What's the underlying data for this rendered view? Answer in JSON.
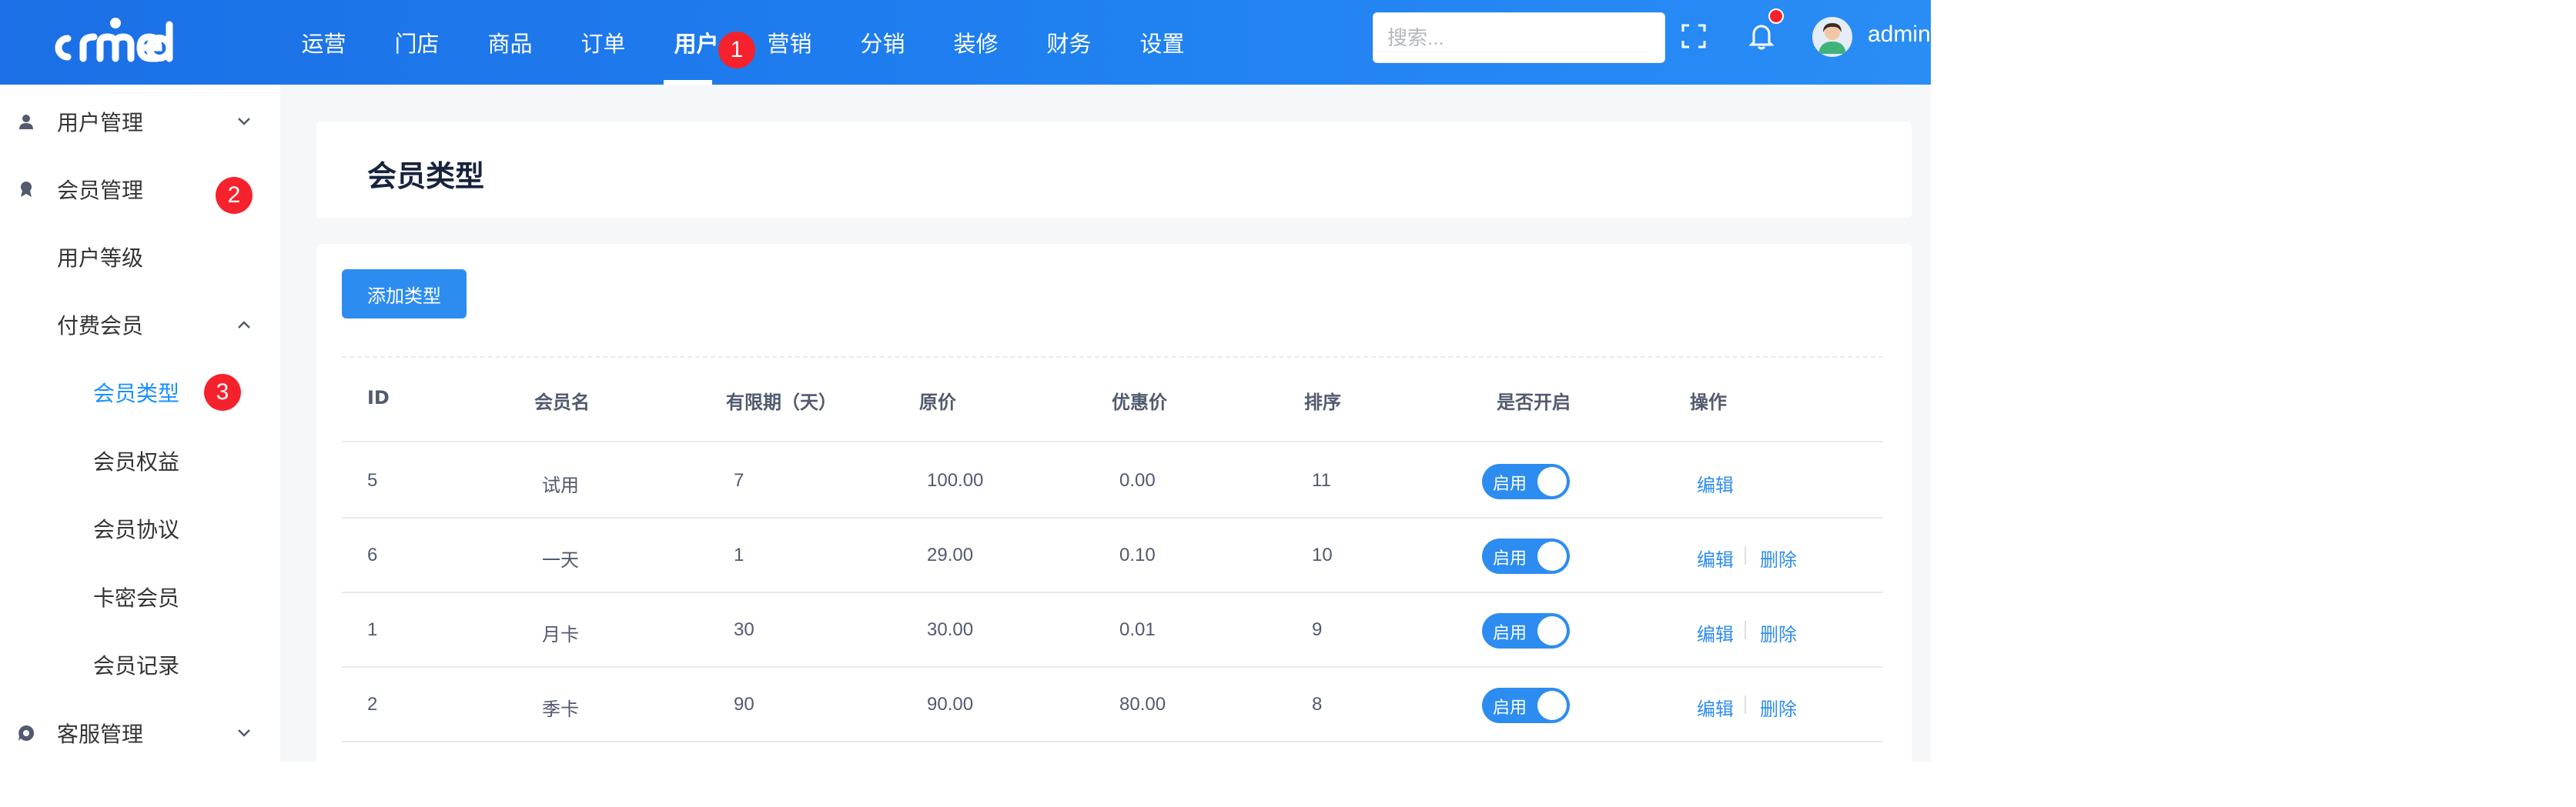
{
  "header": {
    "logo_text": "crmeb",
    "nav": [
      {
        "label": "运营"
      },
      {
        "label": "门店"
      },
      {
        "label": "商品"
      },
      {
        "label": "订单"
      },
      {
        "label": "用户",
        "active": true
      },
      {
        "label": "营销"
      },
      {
        "label": "分销"
      },
      {
        "label": "装修"
      },
      {
        "label": "财务"
      },
      {
        "label": "设置"
      }
    ],
    "search_placeholder": "搜索...",
    "username": "admin",
    "icons": [
      "fullscreen-icon",
      "bell-icon"
    ],
    "accent_color": "#1f80f0"
  },
  "markers": {
    "m1": "1",
    "m2": "2",
    "m3": "3"
  },
  "sidebar": {
    "items": [
      {
        "label": "用户管理"
      },
      {
        "label": "会员管理"
      },
      {
        "label": "用户等级"
      },
      {
        "label": "付费会员"
      },
      {
        "label": "会员类型",
        "active": true
      },
      {
        "label": "会员权益"
      },
      {
        "label": "会员协议"
      },
      {
        "label": "卡密会员"
      },
      {
        "label": "会员记录"
      },
      {
        "label": "客服管理"
      }
    ]
  },
  "page": {
    "title": "会员类型",
    "add_button": "添加类型"
  },
  "table": {
    "headers": [
      "ID",
      "会员名",
      "有限期（天）",
      "原价",
      "优惠价",
      "排序",
      "是否开启",
      "操作"
    ],
    "switch_label": "启用",
    "edit_label": "编辑",
    "delete_label": "删除",
    "rows": [
      {
        "id": "5",
        "name": "试用",
        "days": "7",
        "price": "100.00",
        "discount": "0.00",
        "sort": "11",
        "enabled": true,
        "deletable": false
      },
      {
        "id": "6",
        "name": "一天",
        "days": "1",
        "price": "29.00",
        "discount": "0.10",
        "sort": "10",
        "enabled": true,
        "deletable": true
      },
      {
        "id": "1",
        "name": "月卡",
        "days": "30",
        "price": "30.00",
        "discount": "0.01",
        "sort": "9",
        "enabled": true,
        "deletable": true
      },
      {
        "id": "2",
        "name": "季卡",
        "days": "90",
        "price": "90.00",
        "discount": "80.00",
        "sort": "8",
        "enabled": true,
        "deletable": true
      }
    ]
  }
}
